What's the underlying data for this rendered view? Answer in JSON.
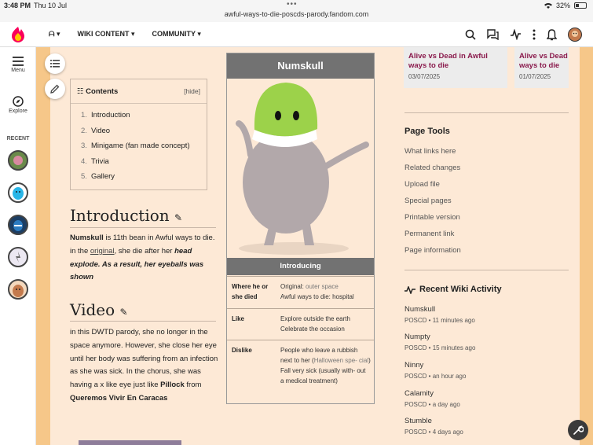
{
  "status_bar": {
    "time": "3:48 PM",
    "date": "Thu 10 Jul",
    "url": "awful-ways-to-die-poscds-parody.fandom.com",
    "battery": "32%"
  },
  "topnav": {
    "items": [
      "WIKI CONTENT",
      "COMMUNITY"
    ]
  },
  "sidebar": {
    "menu_label": "Menu",
    "explore_label": "Explore",
    "recent_label": "RECENT"
  },
  "toc": {
    "title": "Contents",
    "hide_label": "[hide]",
    "items": [
      {
        "num": "1.",
        "label": "Introduction"
      },
      {
        "num": "2.",
        "label": "Video"
      },
      {
        "num": "3.",
        "label": "Minigame (fan made concept)"
      },
      {
        "num": "4.",
        "label": "Trivia"
      },
      {
        "num": "5.",
        "label": "Gallery"
      }
    ]
  },
  "introduction": {
    "heading": "Introduction",
    "name": "Numskull",
    "text1": " is 11th bean in Awful ways to die. in the ",
    "link": "original",
    "text2": ", she die after her ",
    "emph": "head explode. As a result, her eyeballs was shown"
  },
  "video": {
    "heading": "Video",
    "text1": "in this DWTD parody, she no longer in the space anymore. However, she close her eye until her body was suffering from an infection as she was sick. In the chorus, she was having a x like eye just like ",
    "bold1": "Pillock",
    "text2": " from ",
    "bold2": "Queremos Vivir En Caracas"
  },
  "infobox": {
    "title": "Numskull",
    "subheader": "Introducing",
    "rows": [
      {
        "label": "Where he or she died",
        "v1": "Original: ",
        "v1b": "outer space",
        "v2": "Awful ways to die: hospital"
      },
      {
        "label": "Like",
        "v1": "Explore outside the earth",
        "v2": "Celebrate the occasion"
      },
      {
        "label": "Dislike",
        "v1": "People who leave a rubbish next to her (",
        "v1b": "Halloween spe- cial",
        "v1c": ")",
        "v2": "Fall very sick (usually with- out a medical treatment)"
      }
    ]
  },
  "related_cards": [
    {
      "title": "Alive vs Dead in Awful ways to die",
      "date": "03/07/2025"
    },
    {
      "title": "Alive vs Dead ways to die",
      "date": "01/07/2025"
    }
  ],
  "page_tools": {
    "heading": "Page Tools",
    "links": [
      "What links here",
      "Related changes",
      "Upload file",
      "Special pages",
      "Printable version",
      "Permanent link",
      "Page information"
    ]
  },
  "recent_activity": {
    "heading": "Recent Wiki Activity",
    "items": [
      {
        "title": "Numskull",
        "meta": "POSCD • 11 minutes ago"
      },
      {
        "title": "Numpty",
        "meta": "POSCD • 15 minutes ago"
      },
      {
        "title": "Ninny",
        "meta": "POSCD • an hour ago"
      },
      {
        "title": "Calamity",
        "meta": "POSCD • a day ago"
      },
      {
        "title": "Stumble",
        "meta": "POSCD • 4 days ago"
      }
    ]
  },
  "colors": {
    "accent": "#f6c789",
    "link": "#8a1a4c",
    "page_bg": "#fde9d6",
    "bean_green": "#9cd24a"
  }
}
